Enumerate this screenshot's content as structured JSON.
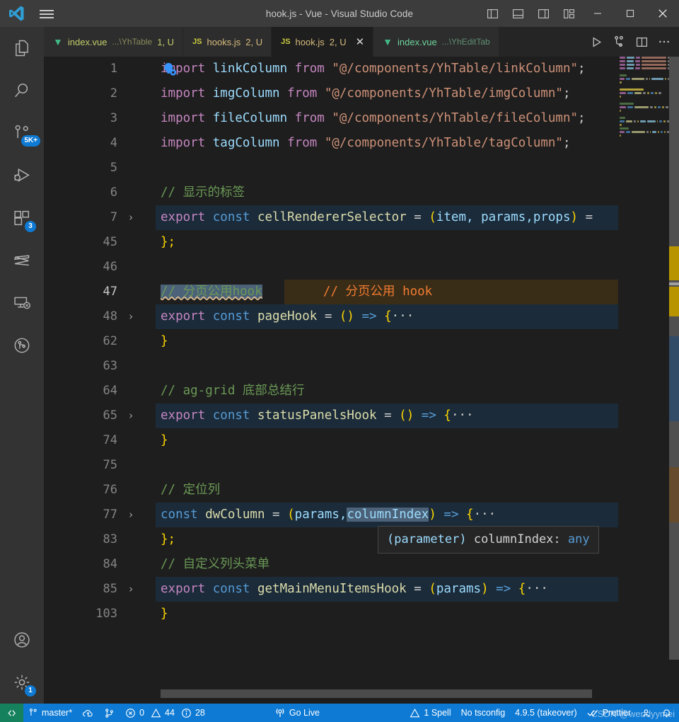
{
  "window": {
    "title": "hook.js - Vue - Visual Studio Code",
    "logo_icon": "vscode-logo-icon",
    "menu_icon": "hamburger-menu-icon",
    "layout_icons": [
      "toggle-primary-sidebar-icon",
      "toggle-panel-icon",
      "toggle-secondary-sidebar-icon",
      "customize-layout-icon"
    ],
    "minimize_label": "—",
    "maximize_label": "☐",
    "close_label": "✕"
  },
  "activitybar": {
    "items": [
      {
        "name": "explorer",
        "icon": "files-icon",
        "badge": ""
      },
      {
        "name": "search",
        "icon": "search-icon",
        "badge": ""
      },
      {
        "name": "source-control",
        "icon": "source-control-icon",
        "badge": "5K+"
      },
      {
        "name": "run-and-debug",
        "icon": "run-and-debug-icon",
        "badge": ""
      },
      {
        "name": "extensions",
        "icon": "extensions-icon",
        "badge": "3"
      },
      {
        "name": "sass-compiler",
        "icon": "sass-icon",
        "badge": ""
      },
      {
        "name": "remote-explorer",
        "icon": "remote-explorer-icon",
        "badge": ""
      },
      {
        "name": "gitlens",
        "icon": "gitlens-icon",
        "badge": ""
      }
    ],
    "bottom": [
      {
        "name": "accounts",
        "icon": "account-icon",
        "badge": ""
      },
      {
        "name": "manage",
        "icon": "gear-icon",
        "badge": "1"
      }
    ]
  },
  "tabs": [
    {
      "icon": "vue-file-icon",
      "label": "index.vue",
      "path": "...\\YhTable",
      "meta": "1, U",
      "active": false,
      "dirty": false,
      "closable": false
    },
    {
      "icon": "js-file-icon",
      "label": "hooks.js",
      "path": "",
      "meta": "2, U",
      "active": false,
      "dirty": false,
      "closable": false
    },
    {
      "icon": "js-file-icon",
      "label": "hook.js",
      "path": "",
      "meta": "2, U",
      "active": true,
      "dirty": false,
      "closable": true
    },
    {
      "icon": "vue-file-icon",
      "label": "index.vue",
      "path": "...\\YhEditTab",
      "meta": "",
      "active": false,
      "dirty": false,
      "closable": false
    }
  ],
  "tab_actions": [
    {
      "name": "run-button",
      "icon": "play-icon"
    },
    {
      "name": "run-and-debug-button",
      "icon": "debug-alt-icon"
    },
    {
      "name": "split-editor-button",
      "icon": "split-editor-icon"
    },
    {
      "name": "more-actions-button",
      "icon": "ellipsis-icon"
    }
  ],
  "editor": {
    "inline_annotation": "// 分页公用 hook",
    "lines": [
      {
        "num": "1",
        "fold": "",
        "highlight": false,
        "tokens": [
          {
            "t": "import ",
            "c": "k-import"
          },
          {
            "t": "linkColumn",
            "c": "k-ident"
          },
          {
            "t": " from ",
            "c": "k-import"
          },
          {
            "t": "\"@/components/YhTable/linkColumn\"",
            "c": "k-str"
          },
          {
            "t": ";",
            "c": "k-punc"
          }
        ]
      },
      {
        "num": "2",
        "fold": "",
        "highlight": false,
        "tokens": [
          {
            "t": "import ",
            "c": "k-import"
          },
          {
            "t": "imgColumn",
            "c": "k-ident"
          },
          {
            "t": " from ",
            "c": "k-import"
          },
          {
            "t": "\"@/components/YhTable/imgColumn\"",
            "c": "k-str"
          },
          {
            "t": ";",
            "c": "k-punc"
          }
        ]
      },
      {
        "num": "3",
        "fold": "",
        "highlight": false,
        "tokens": [
          {
            "t": "import ",
            "c": "k-import"
          },
          {
            "t": "fileColumn",
            "c": "k-ident"
          },
          {
            "t": " from ",
            "c": "k-import"
          },
          {
            "t": "\"@/components/YhTable/fileColumn\"",
            "c": "k-str"
          },
          {
            "t": ";",
            "c": "k-punc"
          }
        ]
      },
      {
        "num": "4",
        "fold": "",
        "highlight": false,
        "tokens": [
          {
            "t": "import ",
            "c": "k-import"
          },
          {
            "t": "tagColumn",
            "c": "k-ident"
          },
          {
            "t": " from ",
            "c": "k-import"
          },
          {
            "t": "\"@/components/YhTable/tagColumn\"",
            "c": "k-str"
          },
          {
            "t": ";",
            "c": "k-punc"
          }
        ]
      },
      {
        "num": "5",
        "fold": "",
        "highlight": false,
        "tokens": []
      },
      {
        "num": "6",
        "fold": "",
        "highlight": false,
        "tokens": [
          {
            "t": "// 显示的标签",
            "c": "k-comment"
          }
        ]
      },
      {
        "num": "7",
        "fold": "›",
        "highlight": true,
        "tokens": [
          {
            "t": "export ",
            "c": "k-import"
          },
          {
            "t": "const ",
            "c": "k-kw"
          },
          {
            "t": "cellRendererSelector",
            "c": "k-func"
          },
          {
            "t": " = ",
            "c": "k-punc"
          },
          {
            "t": "(",
            "c": "k-paren"
          },
          {
            "t": "item, params,props",
            "c": "k-ident"
          },
          {
            "t": ")",
            "c": "k-paren"
          },
          {
            "t": " =",
            "c": "k-punc"
          }
        ]
      },
      {
        "num": "45",
        "fold": "",
        "highlight": false,
        "tokens": [
          {
            "t": "};",
            "c": "k-brace2"
          }
        ]
      },
      {
        "num": "46",
        "fold": "",
        "highlight": false,
        "tokens": []
      },
      {
        "num": "47",
        "fold": "",
        "highlight": false,
        "current": true,
        "selection": "// 分页公用hook",
        "tokens": []
      },
      {
        "num": "48",
        "fold": "›",
        "highlight": true,
        "tokens": [
          {
            "t": "export ",
            "c": "k-import"
          },
          {
            "t": "const ",
            "c": "k-kw"
          },
          {
            "t": "pageHook",
            "c": "k-func"
          },
          {
            "t": " = ",
            "c": "k-punc"
          },
          {
            "t": "()",
            "c": "k-paren"
          },
          {
            "t": " =>",
            "c": "k-kw"
          },
          {
            "t": " {",
            "c": "k-brace2"
          },
          {
            "t": "···",
            "c": "k-dots"
          }
        ]
      },
      {
        "num": "62",
        "fold": "",
        "highlight": false,
        "tokens": [
          {
            "t": "}",
            "c": "k-brace2"
          }
        ]
      },
      {
        "num": "63",
        "fold": "",
        "highlight": false,
        "tokens": []
      },
      {
        "num": "64",
        "fold": "",
        "highlight": false,
        "tokens": [
          {
            "t": "// ag-grid 底部总结行",
            "c": "k-comment"
          }
        ]
      },
      {
        "num": "65",
        "fold": "›",
        "highlight": true,
        "tokens": [
          {
            "t": "export ",
            "c": "k-import"
          },
          {
            "t": "const ",
            "c": "k-kw"
          },
          {
            "t": "statusPanelsHook",
            "c": "k-func"
          },
          {
            "t": " = ",
            "c": "k-punc"
          },
          {
            "t": "()",
            "c": "k-paren"
          },
          {
            "t": " =>",
            "c": "k-kw"
          },
          {
            "t": " {",
            "c": "k-brace2"
          },
          {
            "t": "···",
            "c": "k-dots"
          }
        ]
      },
      {
        "num": "74",
        "fold": "",
        "highlight": false,
        "tokens": [
          {
            "t": "}",
            "c": "k-brace2"
          }
        ]
      },
      {
        "num": "75",
        "fold": "",
        "highlight": false,
        "tokens": []
      },
      {
        "num": "76",
        "fold": "",
        "highlight": false,
        "tokens": [
          {
            "t": "// 定位列",
            "c": "k-comment"
          }
        ]
      },
      {
        "num": "77",
        "fold": "›",
        "highlight": true,
        "tokens": [
          {
            "t": "const ",
            "c": "k-kw"
          },
          {
            "t": "dwColumn",
            "c": "k-func"
          },
          {
            "t": " = ",
            "c": "k-punc"
          },
          {
            "t": "(",
            "c": "k-paren"
          },
          {
            "t": "params,",
            "c": "k-ident"
          },
          {
            "t": "columnIndex",
            "c": "k-ident sel"
          },
          {
            "t": ")",
            "c": "k-paren"
          },
          {
            "t": " =>",
            "c": "k-kw"
          },
          {
            "t": " {",
            "c": "k-brace2"
          },
          {
            "t": "···",
            "c": "k-dots"
          }
        ]
      },
      {
        "num": "83",
        "fold": "",
        "highlight": false,
        "tokens": [
          {
            "t": "};",
            "c": "k-brace2"
          }
        ]
      },
      {
        "num": "84",
        "fold": "",
        "highlight": false,
        "tokens": [
          {
            "t": "// 自定义列头菜单",
            "c": "k-comment"
          }
        ]
      },
      {
        "num": "85",
        "fold": "›",
        "highlight": true,
        "tokens": [
          {
            "t": "export ",
            "c": "k-import"
          },
          {
            "t": "const ",
            "c": "k-kw"
          },
          {
            "t": "getMainMenuItemsHook",
            "c": "k-func"
          },
          {
            "t": " = ",
            "c": "k-punc"
          },
          {
            "t": "(",
            "c": "k-paren"
          },
          {
            "t": "params",
            "c": "k-ident"
          },
          {
            "t": ")",
            "c": "k-paren"
          },
          {
            "t": " =>",
            "c": "k-kw"
          },
          {
            "t": " {",
            "c": "k-brace2"
          },
          {
            "t": "···",
            "c": "k-dots"
          }
        ]
      },
      {
        "num": "103",
        "fold": "",
        "highlight": false,
        "tokens": [
          {
            "t": "}",
            "c": "k-brace2"
          }
        ]
      }
    ],
    "lightbulb_icon": "code-action-lightbulb-icon"
  },
  "hover": {
    "kind": "(parameter)",
    "name": " columnIndex:",
    "type": " any"
  },
  "statusbar": {
    "remote_icon": "remote-window-icon",
    "left": [
      {
        "name": "branch",
        "icon": "source-control-icon",
        "label": "master*"
      },
      {
        "name": "sync-changes",
        "icon": "cloud-sync-icon",
        "label": ""
      },
      {
        "name": "git-graph",
        "icon": "git-graph-icon",
        "label": ""
      },
      {
        "name": "problems",
        "icon": "error-warning-info-icon",
        "label": "0  44  28",
        "errors": "0",
        "warnings": "44",
        "infos": "28"
      }
    ],
    "center": [
      {
        "name": "go-live",
        "icon": "broadcast-icon",
        "label": "Go Live"
      }
    ],
    "right": [
      {
        "name": "spell-check",
        "icon": "warning-icon",
        "label": "1 Spell"
      },
      {
        "name": "tsconfig",
        "icon": "",
        "label": "No tsconfig"
      },
      {
        "name": "typescript-version",
        "icon": "",
        "label": "4.9.5 (takeover)"
      },
      {
        "name": "prettier",
        "icon": "check-all-icon",
        "label": "Prettier"
      },
      {
        "name": "accounts",
        "icon": "account-icon",
        "label": ""
      },
      {
        "name": "notifications",
        "icon": "bell-icon",
        "label": ""
      }
    ]
  },
  "watermark": "CSDN @wendyymei",
  "colors": {
    "accent": "#0e7ad4",
    "remote": "#16825d",
    "editor_bg": "#1e1e1e",
    "titlebar_bg": "#3c3c3c",
    "activitybar_bg": "#333333",
    "comment": "#6a9955",
    "string": "#ce9178",
    "annotation": "#f07b31"
  }
}
